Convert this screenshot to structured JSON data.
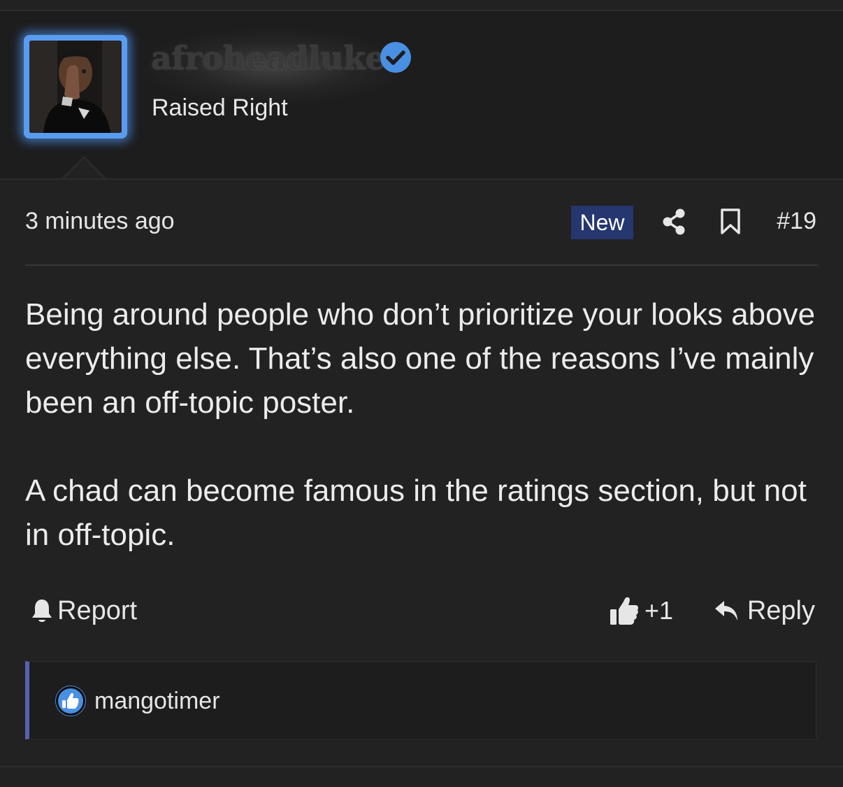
{
  "post": {
    "author": {
      "username": "afroheadluke",
      "title": "Raised Right",
      "verified_icon": "verified-check-icon"
    },
    "meta": {
      "timestamp": "3 minutes ago",
      "new_badge": "New",
      "post_number": "#19"
    },
    "body": {
      "paragraphs": [
        "Being around people who don’t prioritize your looks above everything else. That’s also one of the reasons I’ve mainly been an off-topic poster.",
        "A chad can become famous in the ratings section, but not in off-topic."
      ]
    },
    "actions": {
      "report_label": "Report",
      "like_count": "+1",
      "reply_label": "Reply"
    },
    "reactions": {
      "users": [
        "mangotimer"
      ]
    }
  },
  "colors": {
    "background": "#222223",
    "header_bg": "#1d1d1e",
    "accent_blue": "#4a90e2",
    "new_badge_bg": "#26366e",
    "reaction_border": "#5564b0"
  }
}
